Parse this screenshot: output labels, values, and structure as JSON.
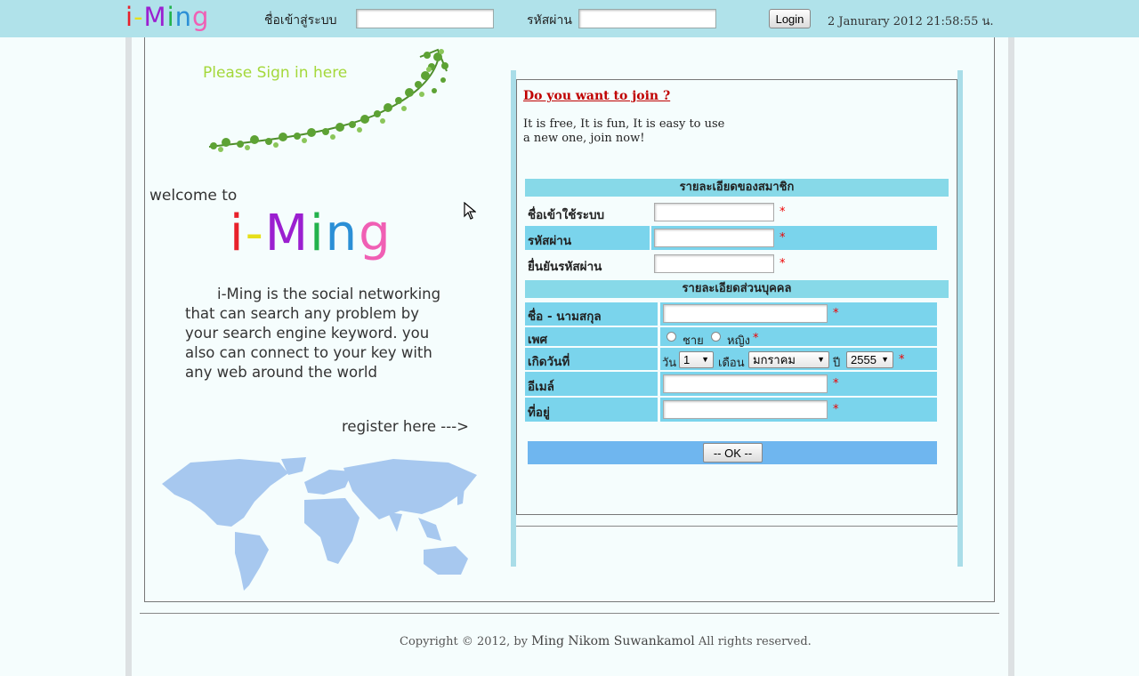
{
  "header": {
    "logo_chars": [
      "i",
      "-",
      "M",
      "i",
      "n",
      "g"
    ],
    "username_label": "ชื่อเข้าสู่ระบบ",
    "password_label": "รหัสผ่าน",
    "login_button": "Login",
    "datetime": "2 Janurary 2012 21:58:55 น."
  },
  "left": {
    "sign_in_text": "Please Sign in here",
    "welcome_text": "welcome to",
    "logo_chars": [
      "i",
      "-",
      "M",
      "i",
      "n",
      "g"
    ],
    "description": "i-Ming is the social networking that can search any problem by your search engine keyword. you also can connect to your key with any web around the world",
    "register_text": "register here --->"
  },
  "join": {
    "title": "Do you want to join ?",
    "line1": "It is free, It is fun, It is easy to use",
    "line2": "a new one, join now!"
  },
  "form": {
    "member_section": "รายละเอียดของสมาชิก",
    "username_label": "ชื่อเข้าใช้ระบบ",
    "password_label": "รหัสผ่าน",
    "confirm_label": "ยื่นยันรหัสผ่าน",
    "personal_section": "รายละเอียดส่วนบุคคล",
    "name_label": "ชื่อ - นามสกุล",
    "gender_label": "เพศ",
    "gender_male": "ชาย",
    "gender_female": "หญิง",
    "birthday_label": "เกิดวันที่",
    "day_label": "วัน",
    "day_value": "1",
    "month_label": "เดือน",
    "month_value": "มกราคม",
    "year_label": "ปี",
    "year_value": "2555",
    "email_label": "อีเมล์",
    "address_label": "ที่อยู่",
    "required_mark": "*",
    "ok_button": "-- OK --"
  },
  "footer": {
    "prefix": "Copyright © 2012, by ",
    "author": "Ming Nikom Suwankamol",
    "suffix": " All rights reserved."
  },
  "colors": {
    "topbar": "#b0e2ea",
    "section_header": "#87d9e8",
    "field_cell": "#7ad4ec",
    "ok_bar": "#6fb6ef",
    "join_title": "#c00000",
    "sign_in": "#a4d83a",
    "map": "#a7c8ef"
  },
  "icons": {
    "vine": "vine-arrow-icon",
    "map": "world-map-icon",
    "cursor": "mouse-cursor-icon"
  }
}
